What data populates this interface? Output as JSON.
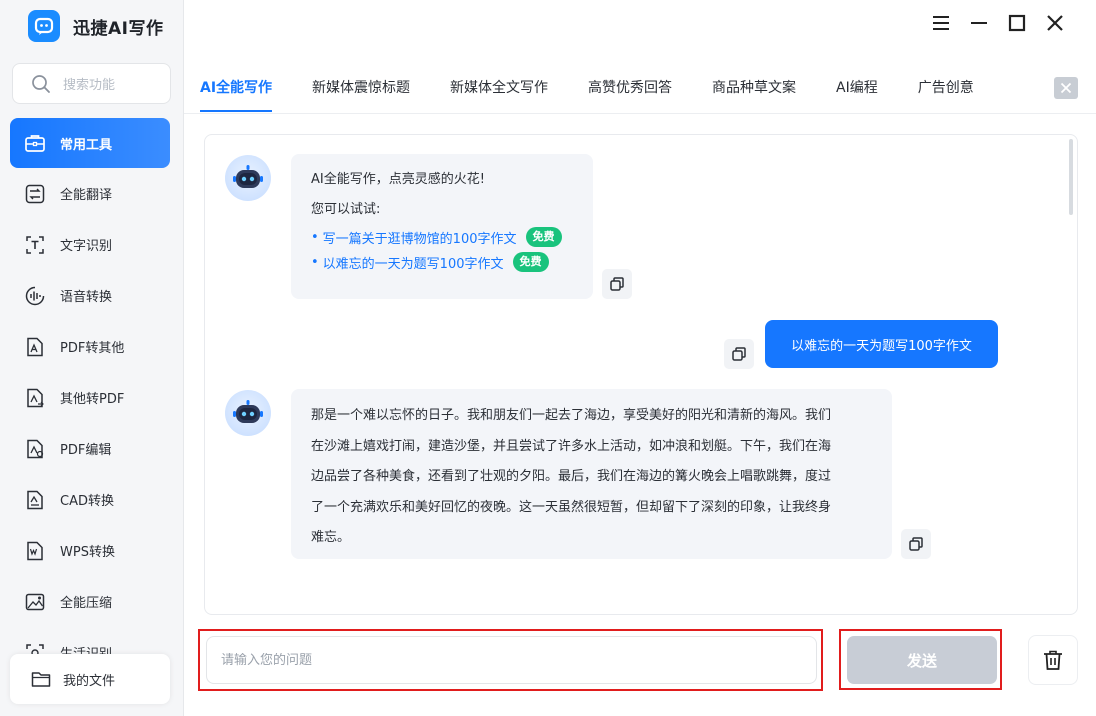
{
  "app": {
    "title": "迅捷AI写作",
    "brand_color": "#1677ff"
  },
  "sidebar": {
    "search_placeholder": "搜索功能",
    "items": [
      {
        "label": "常用工具",
        "icon": "toolbox-icon",
        "active": true
      },
      {
        "label": "全能翻译",
        "icon": "translate-icon"
      },
      {
        "label": "文字识别",
        "icon": "text-ocr-icon"
      },
      {
        "label": "语音转换",
        "icon": "voice-icon"
      },
      {
        "label": "PDF转其他",
        "icon": "pdf-convert-icon"
      },
      {
        "label": "其他转PDF",
        "icon": "to-pdf-icon"
      },
      {
        "label": "PDF编辑",
        "icon": "pdf-edit-icon"
      },
      {
        "label": "CAD转换",
        "icon": "cad-icon"
      },
      {
        "label": "WPS转换",
        "icon": "wps-icon"
      },
      {
        "label": "全能压缩",
        "icon": "compress-icon"
      },
      {
        "label": "生活识别",
        "icon": "scan-icon"
      }
    ],
    "my_files": "我的文件"
  },
  "window_controls": [
    "menu-icon",
    "minimize-icon",
    "maximize-icon",
    "close-icon"
  ],
  "tabs": [
    {
      "label": "AI全能写作",
      "active": true
    },
    {
      "label": "新媒体震惊标题"
    },
    {
      "label": "新媒体全文写作"
    },
    {
      "label": "高赞优秀回答"
    },
    {
      "label": "商品种草文案"
    },
    {
      "label": "AI编程"
    },
    {
      "label": "广告创意"
    }
  ],
  "chat": {
    "welcome": {
      "line1": "AI全能写作，点亮灵感的火花!",
      "line2": "您可以试试:",
      "suggestions": [
        {
          "text": "写一篇关于逛博物馆的100字作文",
          "badge": "免费"
        },
        {
          "text": "以难忘的一天为题写100字作文",
          "badge": "免费"
        }
      ]
    },
    "user_message": "以难忘的一天为题写100字作文",
    "ai_reply": [
      "那是一个难以忘怀的日子。我和朋友们一起去了海边，享受美好的阳光和清新的海风。我们",
      "在沙滩上嬉戏打闹，建造沙堡，并且尝试了许多水上活动，如冲浪和划艇。下午，我们在海",
      "边品尝了各种美食，还看到了壮观的夕阳。最后，我们在海边的篝火晚会上唱歌跳舞，度过",
      "了一个充满欢乐和美好回忆的夜晚。这一天虽然很短暂，但却留下了深刻的印象，让我终身",
      "难忘。"
    ]
  },
  "composer": {
    "placeholder": "请输入您的问题",
    "value": "",
    "send_label": "发送"
  }
}
